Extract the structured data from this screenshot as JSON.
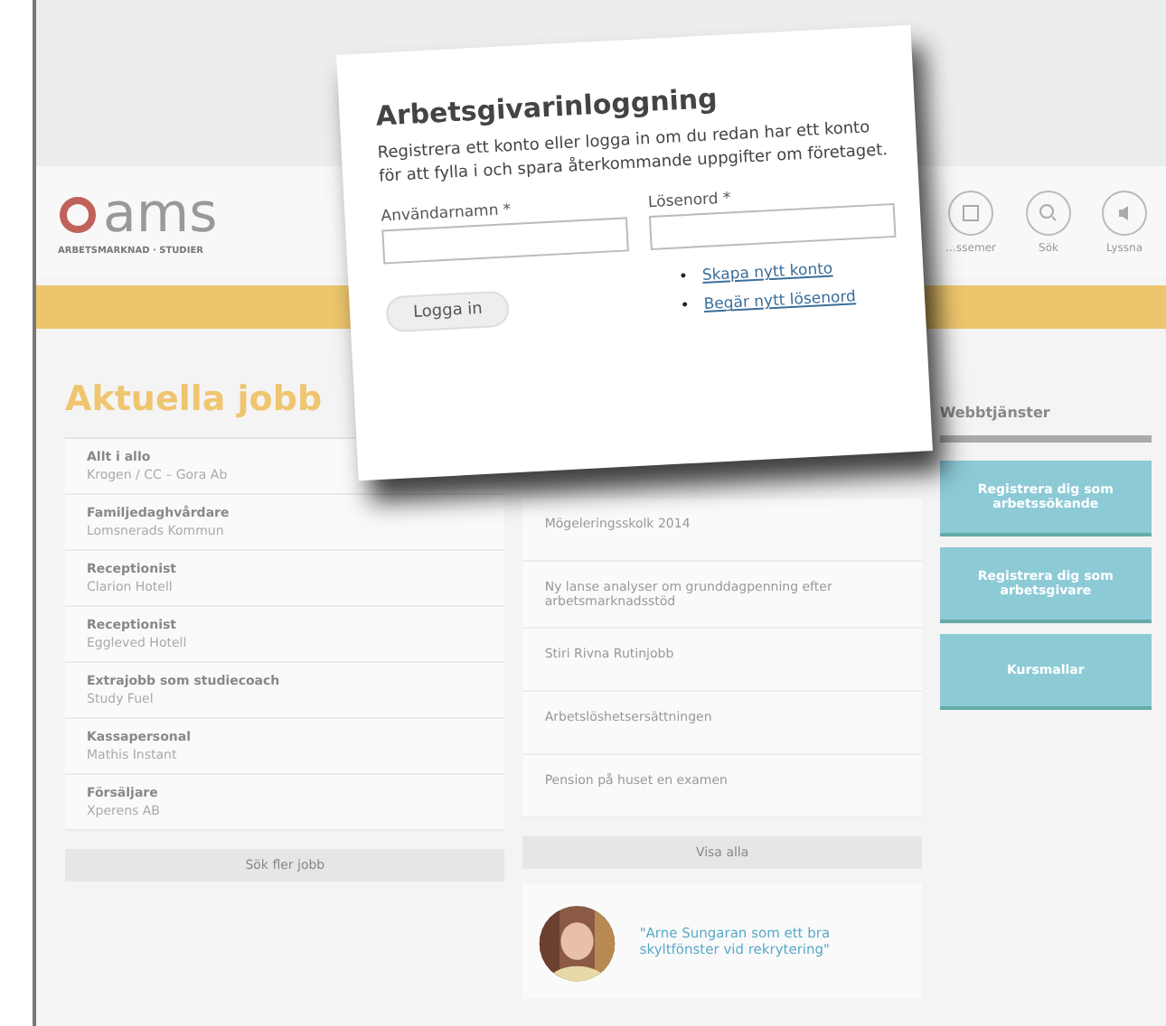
{
  "header": {
    "logo": "ams",
    "tagline": "ARBETSMARKNAD · STUDIER",
    "tools": [
      {
        "kind": "page",
        "label": "…ssemer"
      },
      {
        "kind": "search",
        "label": "Sök"
      },
      {
        "kind": "sound",
        "label": "Lyssna"
      }
    ]
  },
  "jobs": {
    "title": "Aktuella jobb",
    "items": [
      {
        "title": "Allt i allo",
        "company": "Krogen / CC – Gora Ab"
      },
      {
        "title": "Familjedaghvårdare",
        "company": "Lomsnerads Kommun"
      },
      {
        "title": "Receptionist",
        "company": "Clarion Hotell"
      },
      {
        "title": "Receptionist",
        "company": "Eggleved Hotell"
      },
      {
        "title": "Extrajobb som studiecoach",
        "company": "Study Fuel"
      },
      {
        "title": "Kassapersonal",
        "company": "Mathis Instant"
      },
      {
        "title": "Försäljare",
        "company": "Xperens AB"
      }
    ],
    "more": "Sök fler jobb"
  },
  "news": {
    "items": [
      "Mögeleringsskolk 2014",
      "Ny lanse analyser om grunddagpenning efter arbetsmarknadsstöd",
      "Stiri Rivna Rutinjobb",
      "Arbetslöshetsersättningen",
      "Pension på huset en examen"
    ],
    "more": "Visa alla",
    "quote": "\"Arne Sungaran som ett bra skyltfönster vid rekrytering\""
  },
  "services": {
    "title": "Webbtjänster",
    "buttons": [
      "Registrera dig som arbetssökande",
      "Registrera dig som arbetsgivare",
      "Kursmallar"
    ]
  },
  "dialog": {
    "title": "Arbetsgivarinloggning",
    "text": "Registrera ett konto eller logga in om du redan har ett konto för att fylla i och spara återkommande uppgifter om företaget.",
    "username_label": "Användarnamn *",
    "password_label": "Lösenord *",
    "button": "Logga in",
    "bullet": "•",
    "links": [
      "Skapa nytt konto",
      "Begär nytt lösenord"
    ]
  }
}
